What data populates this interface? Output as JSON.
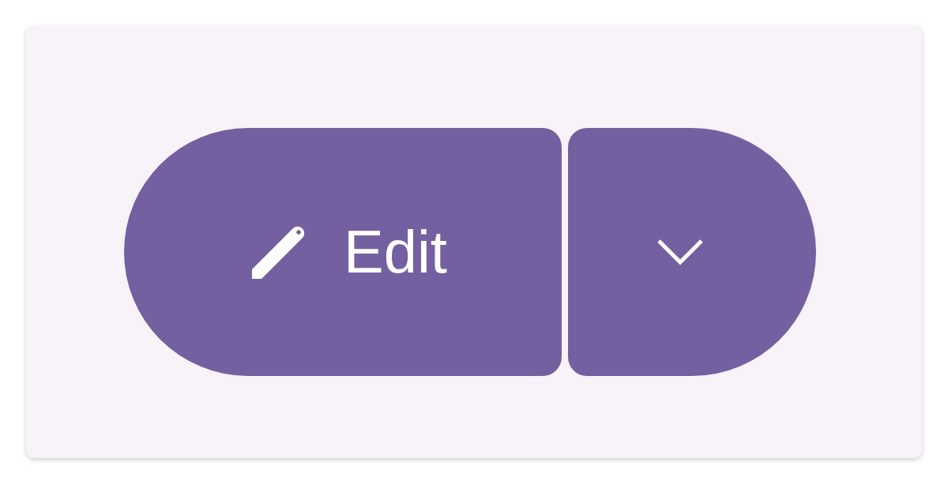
{
  "split_button": {
    "label": "Edit",
    "menu_button": {
      "expanded": false
    }
  }
}
